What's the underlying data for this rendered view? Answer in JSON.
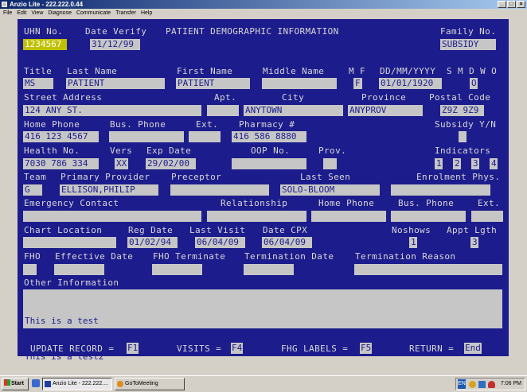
{
  "window": {
    "title": "Anzio Lite - 222.222.0.44"
  },
  "menu": [
    "File",
    "Edit",
    "View",
    "Diagnose",
    "Communicate",
    "Transfer",
    "Help"
  ],
  "header": {
    "uhn_label": "UHN No.",
    "uhn_value": "1234567",
    "date_verify_label": "Date Verify",
    "date_verify_value": "31/12/99",
    "screen_title": "PATIENT DEMOGRAPHIC INFORMATION",
    "family_label": "Family No.",
    "family_value": "SUBSIDY"
  },
  "name_row": {
    "title_label": "Title",
    "title_value": "MS",
    "last_label": "Last Name",
    "last_value": "PATIENT",
    "first_label": "First Name",
    "first_value": "PATIENT",
    "middle_label": "Middle Name",
    "middle_value": "",
    "mf_label": "M F",
    "mf_value": "F",
    "dob_label": "DD/MM/YYYY",
    "dob_value": "01/01/1920",
    "status_label": "S M D W O",
    "status_value": "O"
  },
  "address_row": {
    "street_label": "Street Address",
    "street_value": "124 ANY ST.",
    "apt_label": "Apt.",
    "apt_value": "",
    "city_label": "City",
    "city_value": "ANYTOWN",
    "province_label": "Province",
    "province_value": "ANYPROV",
    "postal_label": "Postal Code",
    "postal_value": "Z9Z 9Z9"
  },
  "phone_row": {
    "home_label": "Home Phone",
    "home_value": "416 123 4567",
    "bus_label": "Bus. Phone",
    "bus_value": "",
    "ext_label": "Ext.",
    "ext_value": "",
    "pharmacy_label": "Pharmacy #",
    "pharmacy_value": "416 586 8880",
    "subsidy_label": "Subsidy Y/N",
    "subsidy_value": ""
  },
  "health_row": {
    "health_label": "Health No.",
    "health_value": "7030 786 334",
    "vers_label": "Vers",
    "vers_value": "XX",
    "exp_label": "Exp Date",
    "exp_value": "29/02/00",
    "oop_label": "OOP No.",
    "oop_value": "",
    "prov_label": "Prov.",
    "prov_value": "",
    "indicators_label": "Indicators",
    "indicators": [
      "1",
      "2",
      "3",
      "4"
    ]
  },
  "team_row": {
    "team_label": "Team",
    "team_value": "G",
    "provider_label": "Primary Provider",
    "provider_value": "ELLISON,PHILIP",
    "preceptor_label": "Preceptor",
    "preceptor_value": "",
    "last_seen_label": "Last Seen",
    "last_seen_value": "SOLO-BLOOM",
    "enrolment_label": "Enrolment Phys.",
    "enrolment_value": ""
  },
  "emergency_row": {
    "contact_label": "Emergency Contact",
    "contact_value": "",
    "relationship_label": "Relationship",
    "relationship_value": "",
    "home_label": "Home Phone",
    "home_value": "",
    "bus_label": "Bus. Phone",
    "bus_value": "",
    "ext_label": "Ext.",
    "ext_value": ""
  },
  "chart_row": {
    "location_label": "Chart Location",
    "location_value": "",
    "reg_label": "Reg Date",
    "reg_value": "01/02/94",
    "last_visit_label": "Last Visit",
    "last_visit_value": "06/04/09",
    "cpx_label": "Date CPX",
    "cpx_value": "06/04/09",
    "noshows_label": "Noshows",
    "noshows_value": "1",
    "appt_label": "Appt Lgth",
    "appt_value": "3"
  },
  "fho_row": {
    "fho_label": "FHO",
    "fho_value": "",
    "effective_label": "Effective Date",
    "effective_value": "",
    "terminate_label": "FHO Terminate",
    "terminate_value": "",
    "term_date_label": "Termination Date",
    "term_date_value": "",
    "term_reason_label": "Termination Reason",
    "term_reason_value": ""
  },
  "other": {
    "label": "Other Information",
    "lines": [
      "This is a test",
      "This is a test2"
    ]
  },
  "footer": {
    "update_label": "UPDATE RECORD =",
    "update_key": "F1",
    "visits_label": "VISITS =",
    "visits_key": "F4",
    "fhg_label": "FHG LABELS =",
    "fhg_key": "F5",
    "return_label": "RETURN =",
    "return_key": "End"
  },
  "taskbar": {
    "start": "Start",
    "items": [
      "Anzio Lite - 222.222....",
      "GoToMeeting"
    ],
    "tray_lang": "EN",
    "clock": "7:06 PM"
  }
}
